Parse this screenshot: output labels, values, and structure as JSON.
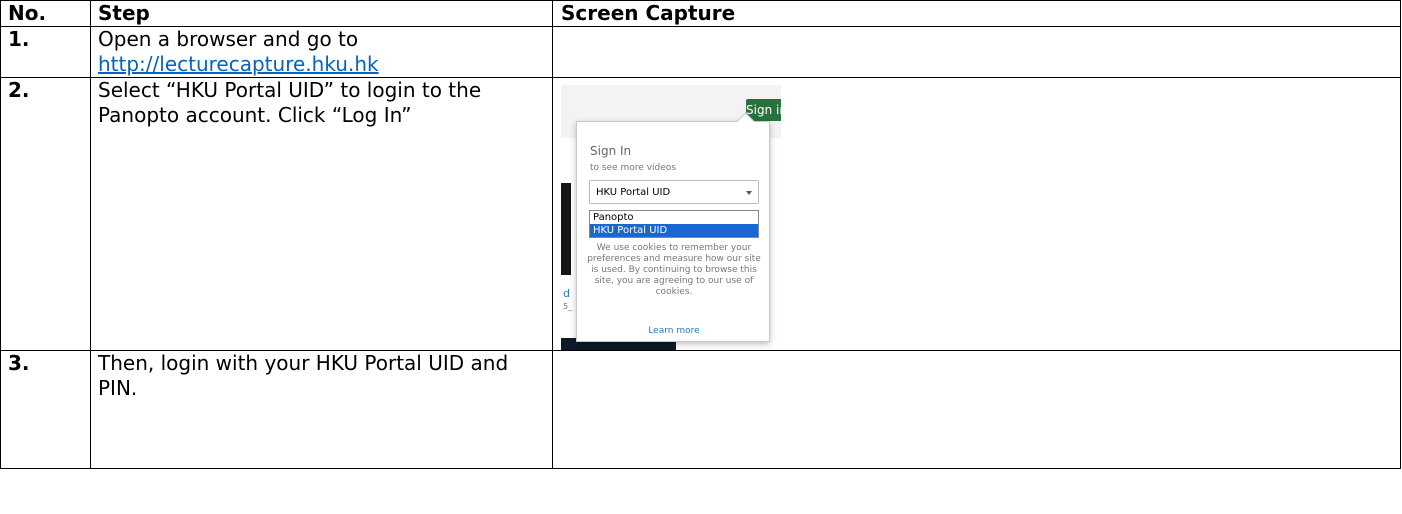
{
  "headers": {
    "no": "No.",
    "step": "Step",
    "capture": "Screen Capture"
  },
  "rows": [
    {
      "no": "1.",
      "text": "Open a browser and go to",
      "link": "http://lecturecapture.hku.hk"
    },
    {
      "no": "2.",
      "text": "Select “HKU Portal UID” to login to the Panopto account. Click “Log In”"
    },
    {
      "no": "3.",
      "text": "Then, login with your HKU Portal UID and PIN."
    }
  ],
  "capture": {
    "sign_in_button": "Sign in",
    "popup_title": "Sign In",
    "popup_subtitle": "to see more videos",
    "select_value": "HKU Portal UID",
    "options": [
      "Panopto",
      "HKU Portal UID"
    ],
    "cookie_notice": "We use cookies to remember your preferences and measure how our site is used. By continuing to browse this site, you are agreeing to our use of cookies.",
    "learn_more": "Learn more",
    "side_chars": [
      "d",
      "5_"
    ]
  }
}
